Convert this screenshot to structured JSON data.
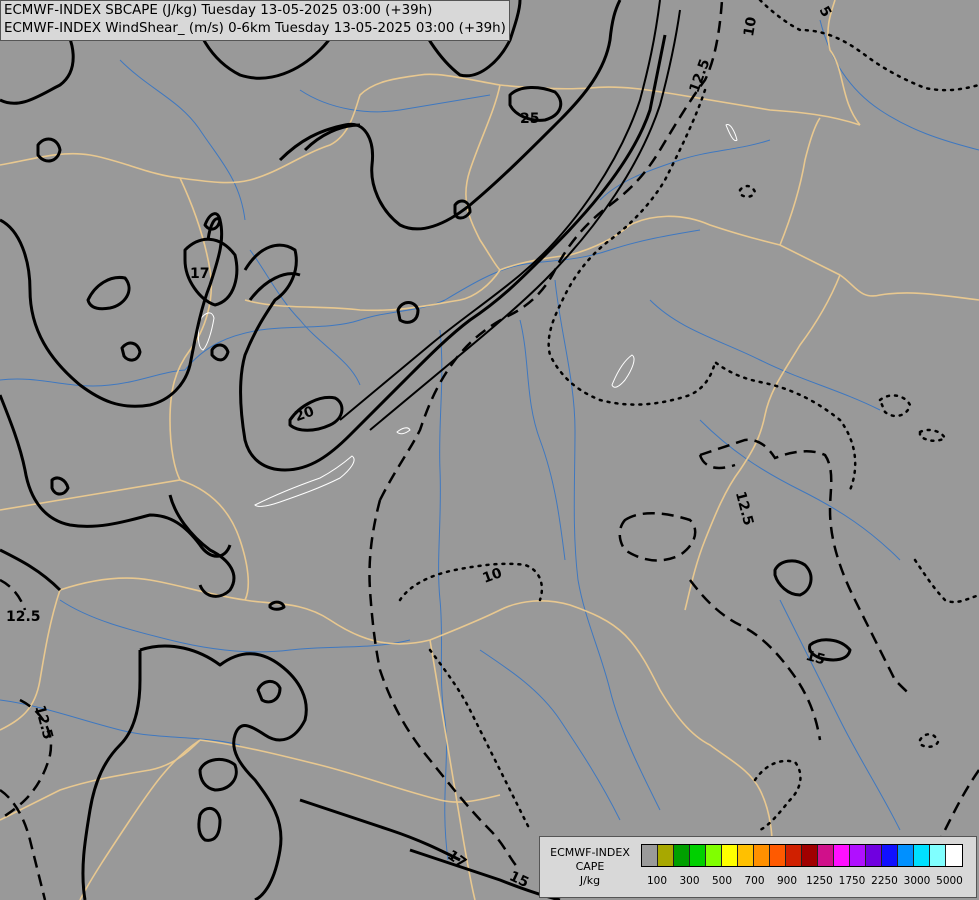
{
  "title": {
    "line1": "ECMWF-INDEX SBCAPE (J/kg) Tuesday 13-05-2025 03:00 (+39h)",
    "line2": "ECMWF-INDEX WindShear_ (m/s) 0-6km Tuesday 13-05-2025 03:00 (+39h)"
  },
  "contour_labels": [
    "5",
    "10",
    "12.5",
    "25",
    "17",
    "20",
    "12.5",
    "10",
    "12.5",
    "12.5",
    "15",
    "17",
    "15"
  ],
  "legend": {
    "name_lines": [
      "ECMWF-INDEX",
      "CAPE",
      "J/kg"
    ],
    "colors": [
      "#9a9a9a",
      "#a8a800",
      "#00a000",
      "#00d000",
      "#80ff00",
      "#ffff00",
      "#ffc000",
      "#ff9000",
      "#ff5a00",
      "#d02000",
      "#a00000",
      "#d0108a",
      "#ff10ff",
      "#b010ff",
      "#7000e0",
      "#1010ff",
      "#0090ff",
      "#00e0ff",
      "#80ffff",
      "#ffffff"
    ],
    "ticks": [
      "100",
      "300",
      "500",
      "700",
      "900",
      "1250",
      "1750",
      "2250",
      "3000",
      "5000"
    ]
  }
}
